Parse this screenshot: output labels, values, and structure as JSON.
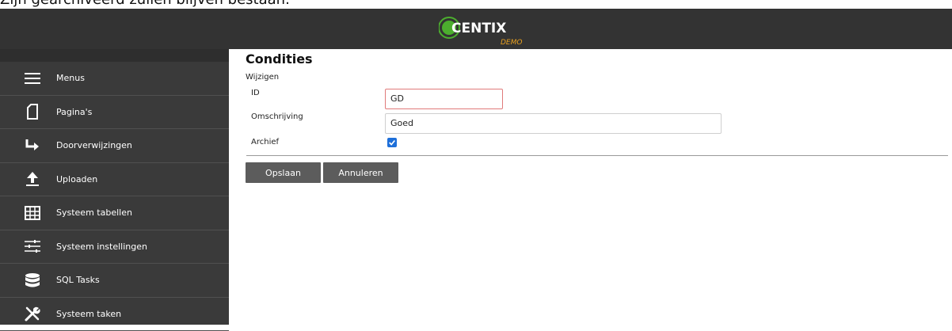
{
  "caption": "Zijn gearchiveerd zullen blijven bestaan.",
  "brand": {
    "name": "CENTIX",
    "sub": "DEMO"
  },
  "sidebar": {
    "items": [
      {
        "label": "Menus",
        "icon": "hamburger-icon"
      },
      {
        "label": "Pagina's",
        "icon": "page-icon"
      },
      {
        "label": "Doorverwijzingen",
        "icon": "redirect-arrow-icon"
      },
      {
        "label": "Uploaden",
        "icon": "upload-icon"
      },
      {
        "label": "Systeem tabellen",
        "icon": "table-icon"
      },
      {
        "label": "Systeem instellingen",
        "icon": "sliders-icon"
      },
      {
        "label": "SQL Tasks",
        "icon": "database-icon"
      },
      {
        "label": "Systeem taken",
        "icon": "tools-icon"
      }
    ]
  },
  "main": {
    "title": "Condities",
    "subtitle": "Wijzigen",
    "fields": {
      "id": {
        "label": "ID",
        "value": "GD"
      },
      "description": {
        "label": "Omschrijving",
        "value": "Goed"
      },
      "archive": {
        "label": "Archief",
        "checked": true
      }
    },
    "buttons": {
      "save": "Opslaan",
      "cancel": "Annuleren"
    }
  },
  "colors": {
    "topbar": "#333333",
    "sidebar": "#3a3a3a",
    "logo_green": "#4cae2e",
    "logo_orange": "#e8a020",
    "button": "#5c5c5c",
    "checkbox": "#1e6fd9",
    "error_border": "#e07a7a"
  }
}
